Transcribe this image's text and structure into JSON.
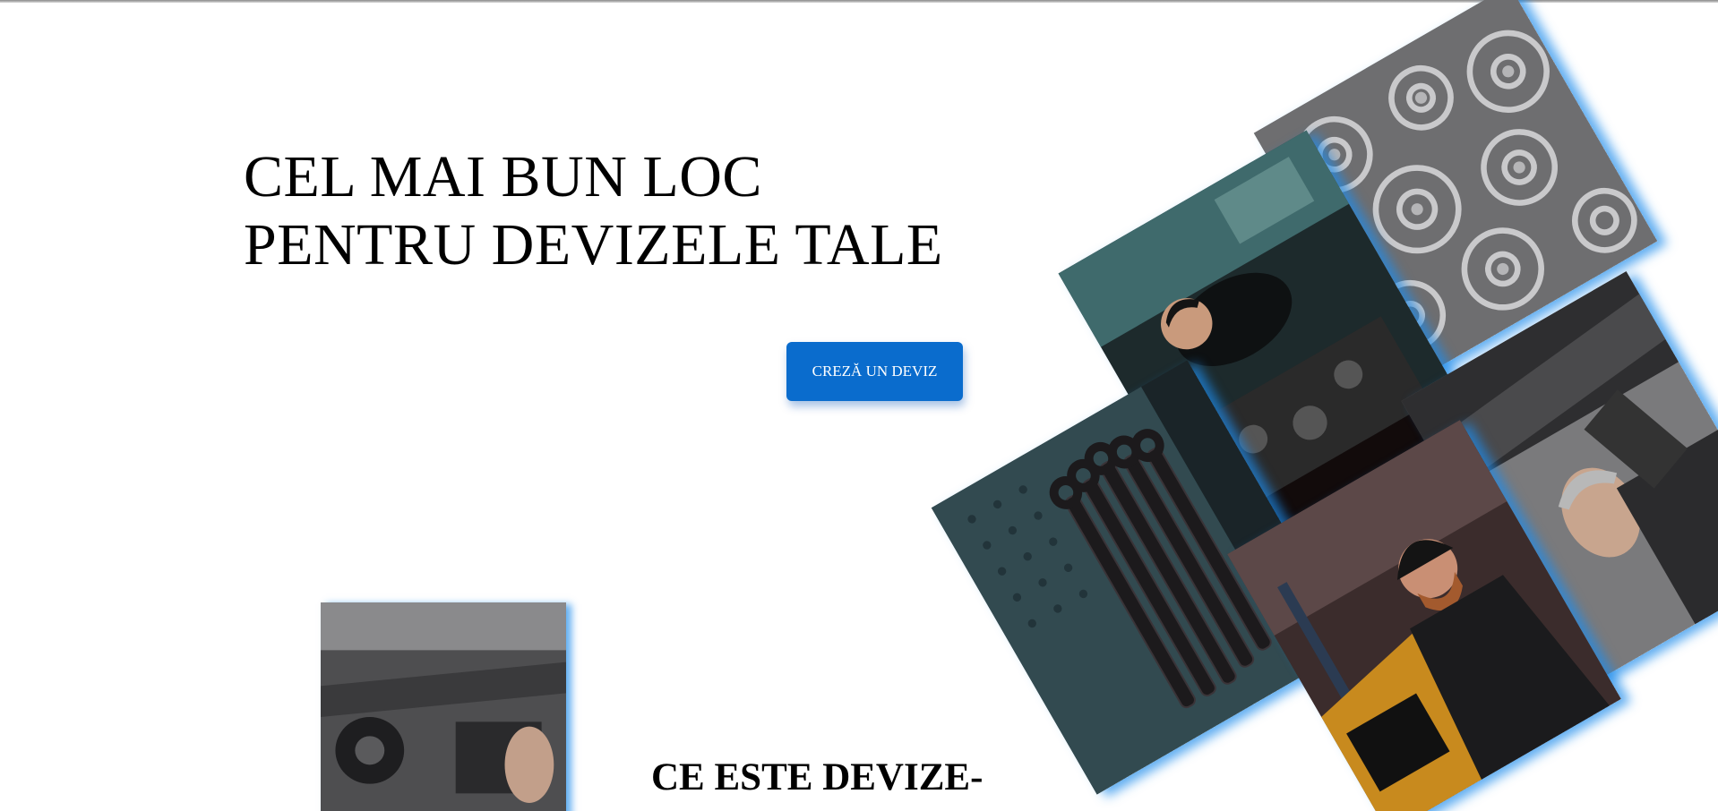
{
  "hero": {
    "title_line1": "CEL MAI BUN LOC",
    "title_line2": "PENTRU DEVIZELE TALE",
    "cta_label": "CREZĂ UN DEVIZ"
  },
  "section": {
    "heading": "CE ESTE DEVIZE-"
  },
  "gallery": {
    "tiles": [
      {
        "name": "gears-photo",
        "subject": "metal gears"
      },
      {
        "name": "mechanic-engine-photo",
        "subject": "mechanic working on engine"
      },
      {
        "name": "mechanic-under-car-photo",
        "subject": "mechanic under car"
      },
      {
        "name": "wrenches-photo",
        "subject": "wrenches on pegboard"
      },
      {
        "name": "mechanic-beanie-photo",
        "subject": "mechanic with beanie"
      },
      {
        "name": "undercarriage-photo",
        "subject": "car undercarriage"
      }
    ]
  },
  "colors": {
    "accent": "#0a6ccd",
    "tile_glow": "#1e8ceb",
    "text": "#000000",
    "background": "#ffffff"
  }
}
